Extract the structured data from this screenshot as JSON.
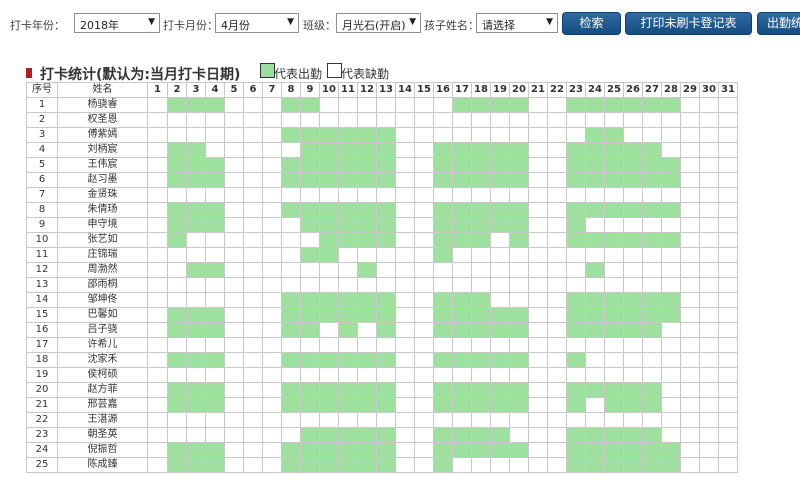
{
  "filters": {
    "year_label": "打卡年份：",
    "year_value": "2018年",
    "month_label": "打卡月份：",
    "month_value": "4月份",
    "class_label": "班级：",
    "class_value": "月光石(开启)",
    "child_label": "孩子姓名：",
    "child_value": "请选择"
  },
  "buttons": {
    "search": "检索",
    "print": "打印未刷卡登记表",
    "more": "出勤统"
  },
  "section": {
    "title": "打卡统计(默认为:当月打卡日期)",
    "legend_present": "代表出勤",
    "legend_absent": "代表缺勤"
  },
  "table": {
    "col_seq": "序号",
    "col_name": "姓名",
    "days": [
      "1",
      "2",
      "3",
      "4",
      "5",
      "6",
      "7",
      "8",
      "9",
      "10",
      "11",
      "12",
      "13",
      "14",
      "15",
      "16",
      "17",
      "18",
      "19",
      "20",
      "21",
      "22",
      "23",
      "24",
      "25",
      "26",
      "27",
      "28",
      "29",
      "30",
      "31"
    ],
    "rows": [
      {
        "seq": "1",
        "name": "杨骁睿",
        "present": [
          2,
          3,
          4,
          8,
          9,
          17,
          18,
          19,
          20,
          23,
          24,
          25,
          26,
          27,
          28
        ]
      },
      {
        "seq": "2",
        "name": "权圣恩",
        "present": []
      },
      {
        "seq": "3",
        "name": "傅紫嫣",
        "present": [
          8,
          9,
          10,
          11,
          12,
          13,
          24,
          25
        ]
      },
      {
        "seq": "4",
        "name": "刘柄宸",
        "present": [
          2,
          3,
          9,
          10,
          11,
          12,
          13,
          16,
          17,
          18,
          19,
          20,
          23,
          24,
          25,
          26,
          27
        ]
      },
      {
        "seq": "5",
        "name": "王伟宸",
        "present": [
          2,
          3,
          4,
          8,
          9,
          10,
          11,
          12,
          13,
          16,
          17,
          18,
          19,
          20,
          23,
          24,
          25,
          26,
          27,
          28
        ]
      },
      {
        "seq": "6",
        "name": "赵习墨",
        "present": [
          2,
          3,
          4,
          8,
          9,
          10,
          11,
          12,
          13,
          16,
          17,
          18,
          19,
          20,
          23,
          24,
          25,
          26,
          27,
          28
        ]
      },
      {
        "seq": "7",
        "name": "金贤珠",
        "present": []
      },
      {
        "seq": "8",
        "name": "朱倩玚",
        "present": [
          2,
          3,
          4,
          8,
          9,
          10,
          11,
          12,
          13,
          16,
          17,
          18,
          19,
          20,
          23,
          24,
          25,
          26,
          27,
          28
        ]
      },
      {
        "seq": "9",
        "name": "申守境",
        "present": [
          2,
          3,
          4,
          9,
          10,
          11,
          12,
          13,
          16,
          17,
          18,
          19,
          20,
          23
        ]
      },
      {
        "seq": "10",
        "name": "张艺如",
        "present": [
          2,
          10,
          11,
          12,
          13,
          16,
          17,
          18,
          20,
          23,
          24,
          25,
          26,
          27,
          28
        ]
      },
      {
        "seq": "11",
        "name": "庄锦瑞",
        "present": [
          9,
          10,
          16
        ]
      },
      {
        "seq": "12",
        "name": "周渤然",
        "present": [
          3,
          4,
          12,
          24
        ]
      },
      {
        "seq": "13",
        "name": "邵雨桐",
        "present": []
      },
      {
        "seq": "14",
        "name": "邹坤佟",
        "present": [
          8,
          9,
          10,
          11,
          12,
          13,
          16,
          17,
          18,
          23,
          24,
          25,
          26,
          27,
          28
        ]
      },
      {
        "seq": "15",
        "name": "巴馨如",
        "present": [
          2,
          3,
          4,
          8,
          9,
          10,
          11,
          12,
          13,
          16,
          17,
          18,
          19,
          20,
          23,
          24,
          25,
          26,
          27,
          28
        ]
      },
      {
        "seq": "16",
        "name": "吕子骁",
        "present": [
          2,
          3,
          4,
          8,
          9,
          11,
          13,
          16,
          17,
          18,
          19,
          20,
          23,
          24,
          25,
          26,
          27
        ]
      },
      {
        "seq": "17",
        "name": "许希儿",
        "present": []
      },
      {
        "seq": "18",
        "name": "沈家禾",
        "present": [
          2,
          3,
          4,
          8,
          9,
          10,
          11,
          12,
          13,
          16,
          17,
          18,
          19,
          20,
          23
        ]
      },
      {
        "seq": "19",
        "name": "侯柯硕",
        "present": []
      },
      {
        "seq": "20",
        "name": "赵方菲",
        "present": [
          2,
          3,
          4,
          8,
          9,
          10,
          11,
          12,
          13,
          16,
          17,
          18,
          19,
          20,
          23,
          24,
          25,
          26,
          27
        ]
      },
      {
        "seq": "21",
        "name": "邢芸嘉",
        "present": [
          2,
          3,
          4,
          8,
          9,
          10,
          11,
          12,
          13,
          16,
          17,
          18,
          19,
          20,
          23,
          25,
          26,
          27
        ]
      },
      {
        "seq": "22",
        "name": "王湛源",
        "present": []
      },
      {
        "seq": "23",
        "name": "朝圣英",
        "present": [
          9,
          10,
          11,
          12,
          13,
          16,
          17,
          18,
          19,
          23,
          24,
          25,
          26,
          27
        ]
      },
      {
        "seq": "24",
        "name": "倪振哲",
        "present": [
          2,
          3,
          4,
          8,
          9,
          10,
          11,
          12,
          13,
          16,
          17,
          18,
          19,
          20,
          23,
          24,
          25,
          26,
          27,
          28
        ]
      },
      {
        "seq": "25",
        "name": "陈成臻",
        "present": [
          2,
          3,
          4,
          8,
          9,
          10,
          11,
          12,
          13,
          16,
          23,
          24,
          25,
          26,
          27,
          28
        ]
      }
    ]
  }
}
